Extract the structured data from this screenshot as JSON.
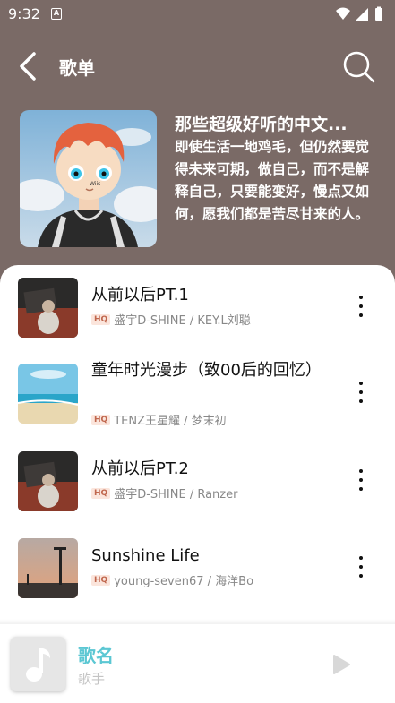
{
  "status_bar": {
    "time": "9:32",
    "notif_letter": "A"
  },
  "header": {
    "title": "歌单"
  },
  "playlist": {
    "title": "那些超级好听的中文...",
    "description": "即使生活一地鸡毛，但仍然要觉得未来可期，做自己，而不是解释自己，只要能变好，慢点又如何，愿我们都是苦尽甘来的人。",
    "cover_text": "Wiis"
  },
  "songs": [
    {
      "title": "从前以后PT.1",
      "quality": "HQ",
      "artists": "盛宇D-SHINE / KEY.L刘聪"
    },
    {
      "title": "童年时光漫步（致00后的回忆）",
      "quality": "HQ",
      "artists": "TENZ王星耀 / 梦末初"
    },
    {
      "title": "从前以后PT.2",
      "quality": "HQ",
      "artists": "盛宇D-SHINE / Ranzer"
    },
    {
      "title": "Sunshine Life",
      "quality": "HQ",
      "artists": "young-seven67 / 海洋Bo"
    }
  ],
  "mini_player": {
    "title": "歌名",
    "artist": "歌手"
  },
  "colors": {
    "background": "#7a6a66",
    "accent": "#5bc7d3",
    "hq_text": "#c0674e",
    "hq_bg": "#fbe5dc"
  }
}
